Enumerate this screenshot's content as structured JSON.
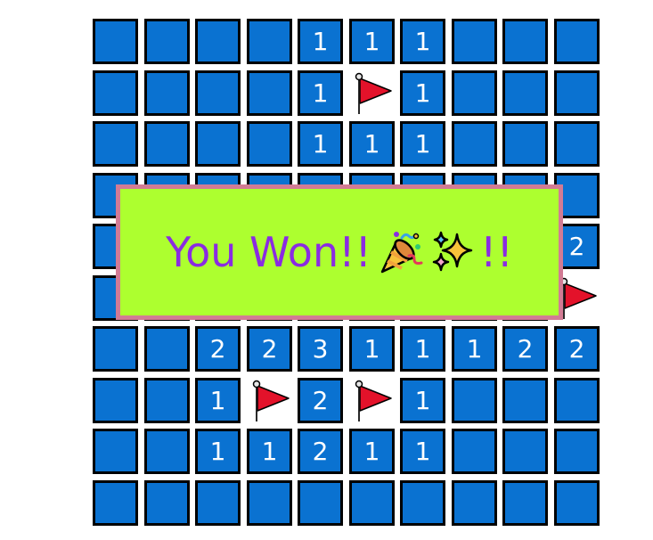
{
  "board": {
    "rows": 10,
    "cols": 10,
    "grid": [
      [
        "H",
        "H",
        "H",
        "H",
        "1",
        "1",
        "1",
        "H",
        "H",
        "H"
      ],
      [
        "H",
        "H",
        "H",
        "H",
        "1",
        "F",
        "1",
        "H",
        "H",
        "H"
      ],
      [
        "H",
        "H",
        "H",
        "H",
        "1",
        "1",
        "1",
        "H",
        "H",
        "H"
      ],
      [
        "H",
        "H",
        "H",
        "H",
        "H",
        "H",
        "H",
        "H",
        "H",
        "H"
      ],
      [
        "H",
        "H",
        "H",
        "H",
        "H",
        "H",
        "H",
        "H",
        "H",
        "2"
      ],
      [
        "H",
        "H",
        "H",
        "H",
        "H",
        "H",
        "H",
        "H",
        "H",
        "F"
      ],
      [
        "H",
        "H",
        "2",
        "2",
        "3",
        "1",
        "1",
        "1",
        "2",
        "2"
      ],
      [
        "H",
        "H",
        "1",
        "F",
        "2",
        "F",
        "1",
        "H",
        "H",
        "H"
      ],
      [
        "H",
        "H",
        "1",
        "1",
        "2",
        "1",
        "1",
        "H",
        "H",
        "H"
      ],
      [
        "H",
        "H",
        "H",
        "H",
        "H",
        "H",
        "H",
        "H",
        "H",
        "H"
      ]
    ],
    "colors": {
      "covered": "#0a72d1",
      "number_text": "#ffffff",
      "border": "#000000",
      "flag": "#e3122a"
    }
  },
  "banner": {
    "text": "You Won!!",
    "suffix": "!!",
    "emoji_1": "party-popper-icon",
    "emoji_2": "sparkles-icon",
    "background": "#adff2f",
    "border_color": "#d27b94",
    "text_color": "#8a2be2"
  }
}
